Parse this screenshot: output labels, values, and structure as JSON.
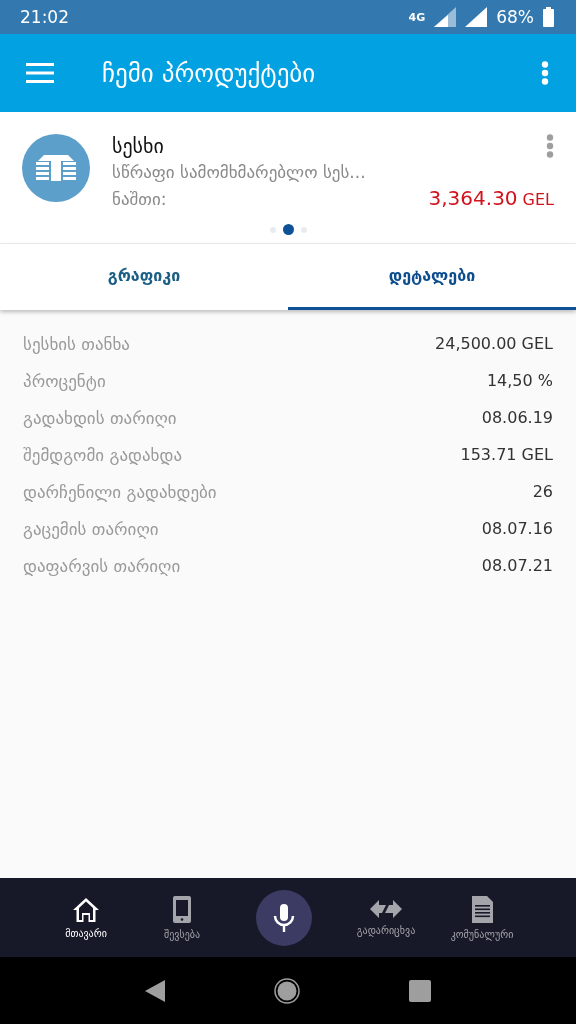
{
  "status_bar": {
    "time": "21:02",
    "network": "4G",
    "battery": "68%"
  },
  "app_bar": {
    "title": "ჩემი პროდუქტები"
  },
  "product": {
    "name": "სესხი",
    "description": "სწრაფი სამომხმარებლო სეს...",
    "balance_label": "ნაშთი:",
    "balance_amount": "3,364.30",
    "currency": "GEL"
  },
  "pager_dots": [
    {
      "selected": false
    },
    {
      "selected": true
    },
    {
      "selected": false
    }
  ],
  "tabs": [
    {
      "label": "გრაფიკი",
      "selected": false
    },
    {
      "label": "დეტალები",
      "selected": true
    }
  ],
  "details": [
    {
      "label": "სესხის თანხა",
      "value": "24,500.00 GEL"
    },
    {
      "label": "პროცენტი",
      "value": "14,50 %"
    },
    {
      "label": "გადახდის თარიღი",
      "value": "08.06.19"
    },
    {
      "label": "შემდგომი გადახდა",
      "value": "153.71 GEL"
    },
    {
      "label": "დარჩენილი გადახდები",
      "value": "26"
    },
    {
      "label": "გაცემის თარიღი",
      "value": "08.07.16"
    },
    {
      "label": "დაფარვის თარიღი",
      "value": "08.07.21"
    }
  ],
  "bottom_nav": [
    {
      "kind": "home",
      "label": "მთავარი",
      "selected": true
    },
    {
      "kind": "phone",
      "label": "შევსება",
      "selected": false
    },
    {
      "kind": "mic"
    },
    {
      "kind": "transfer",
      "label": "გადარიცხვა",
      "selected": false
    },
    {
      "kind": "document",
      "label": "კომუნალური",
      "selected": false
    }
  ]
}
